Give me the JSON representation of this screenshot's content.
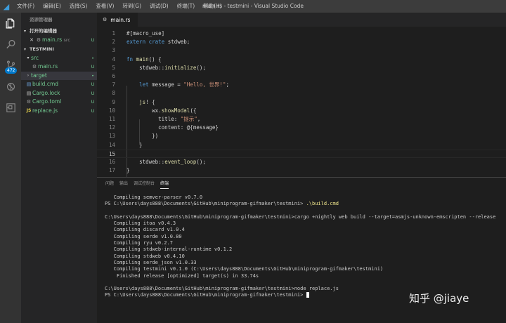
{
  "window": {
    "title": "main.rs - testmini - Visual Studio Code",
    "menu": [
      "文件(F)",
      "编辑(E)",
      "选择(S)",
      "查看(V)",
      "转到(G)",
      "调试(D)",
      "终端(T)",
      "帮助(H)"
    ]
  },
  "activity": {
    "scm_badge": "472",
    "icons": [
      "files-icon",
      "search-icon",
      "source-control-icon",
      "debug-icon",
      "extensions-icon"
    ]
  },
  "sidebar": {
    "title": "资源管理器",
    "open_editors_header": "打开的编辑器",
    "open_editors": [
      {
        "name": "main.rs",
        "path": "src",
        "status": "U"
      }
    ],
    "folder_header": "TESTMINI",
    "tree": [
      {
        "name": "src",
        "type": "folder",
        "status": "•"
      },
      {
        "name": "main.rs",
        "type": "file",
        "status": "U"
      },
      {
        "name": "target",
        "type": "folder",
        "status": "•"
      },
      {
        "name": "build.cmd",
        "type": "file",
        "status": "U"
      },
      {
        "name": "Cargo.lock",
        "type": "file",
        "status": "U"
      },
      {
        "name": "Cargo.toml",
        "type": "file",
        "status": "U"
      },
      {
        "name": "replace.js",
        "type": "file",
        "status": "U"
      }
    ]
  },
  "editor": {
    "tab_label": "main.rs",
    "current_line": 15,
    "lines": [
      "#[macro_use]",
      "extern crate stdweb;",
      "",
      "fn main() {",
      "    stdweb::initialize();",
      "",
      "    let message = \"Hello, 世界!\";",
      "",
      "    js! {",
      "        wx.showModal({",
      "          title: \"提示\",",
      "          content: @{message}",
      "        })",
      "    }",
      "",
      "    stdweb::event_loop();",
      "}"
    ]
  },
  "panel": {
    "tabs": [
      "问题",
      "输出",
      "调试控制台",
      "终端"
    ],
    "active_tab": 3,
    "terminal_lines": [
      "   Compiling semver-parser v0.7.0",
      "PS C:\\Users\\days888\\Documents\\GitHub\\miniprogram-gifmaker\\testmini> .\\build.cmd",
      "",
      "C:\\Users\\days888\\Documents\\GitHub\\miniprogram-gifmaker\\testmini>cargo +nightly web build --target=asmjs-unknown-emscripten --release",
      "   Compiling itoa v0.4.3",
      "   Compiling discard v1.0.4",
      "   Compiling serde v1.0.80",
      "   Compiling ryu v0.2.7",
      "   Compiling stdweb-internal-runtime v0.1.2",
      "   Compiling stdweb v0.4.10",
      "   Compiling serde_json v1.0.33",
      "   Compiling testmini v0.1.0 (C:\\Users\\days888\\Documents\\GitHub\\miniprogram-gifmaker\\testmini)",
      "    Finished release [optimized] target(s) in 33.74s",
      "",
      "C:\\Users\\days888\\Documents\\GitHub\\miniprogram-gifmaker\\testmini>node replace.js",
      "PS C:\\Users\\days888\\Documents\\GitHub\\miniprogram-gifmaker\\testmini> "
    ]
  },
  "watermark": "知乎 @jiaye",
  "colors": {
    "accent": "#007acc",
    "git_untracked": "#73c991",
    "keyword": "#569cd6",
    "function": "#dcdcaa",
    "string": "#ce9178"
  }
}
